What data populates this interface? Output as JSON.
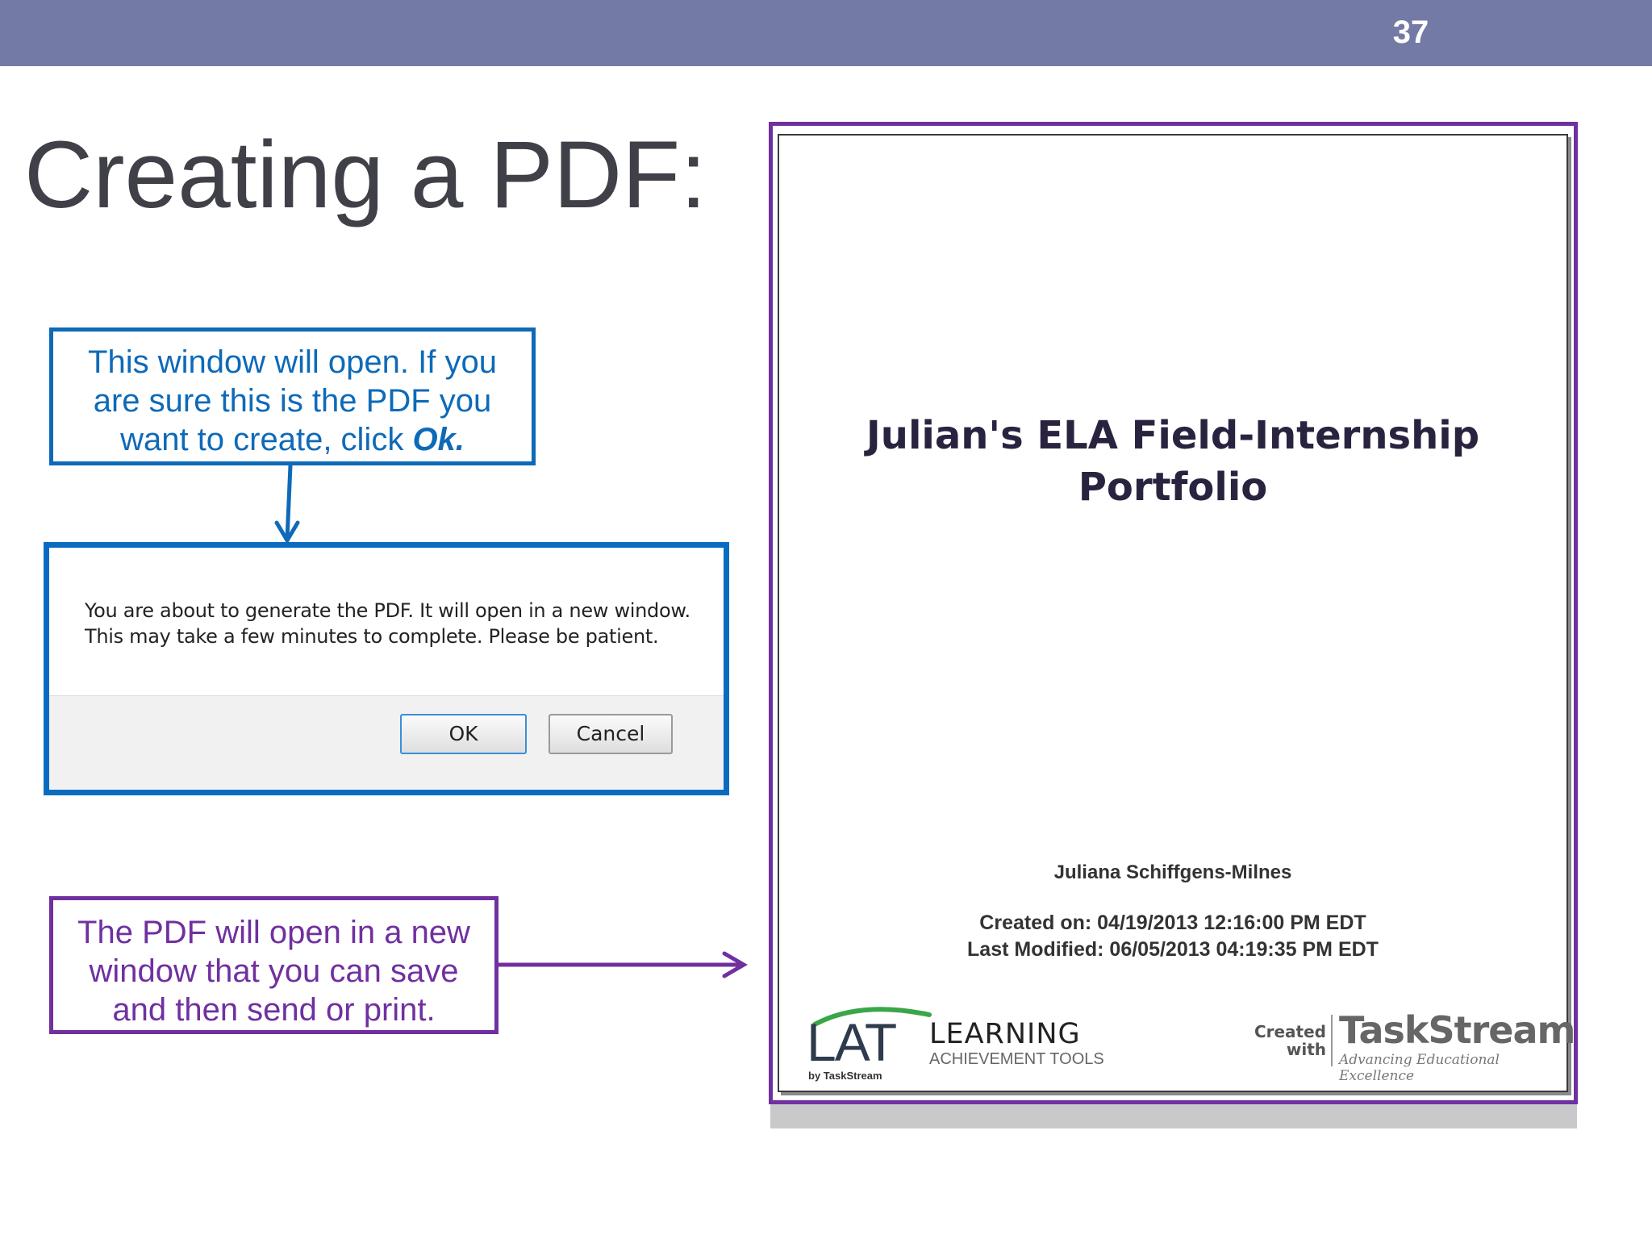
{
  "slide": {
    "number": "37",
    "title": "Creating a PDF:"
  },
  "callout_top": {
    "lines": [
      "This window will open. If you",
      "are sure this is the PDF you"
    ],
    "line3_prefix": "want to create, click ",
    "line3_emphasis": "Ok."
  },
  "dialog": {
    "message_line1": "You are about to generate the PDF. It will open in a new window.",
    "message_line2": "This may take a few minutes to complete. Please be patient.",
    "ok_label": "OK",
    "cancel_label": "Cancel"
  },
  "callout_bottom": {
    "lines": [
      "The PDF will open in a new",
      "window that you can save",
      "and then send or print."
    ]
  },
  "pdf_preview": {
    "title_line1": "Julian's ELA Field-Internship",
    "title_line2": "Portfolio",
    "author": "Juliana Schiffgens-Milnes",
    "created_on": "Created on: 04/19/2013 12:16:00 PM EDT",
    "last_modified": "Last Modified: 06/05/2013 04:19:35 PM EDT",
    "lat_logo": {
      "letters": "LAT",
      "by": "by TaskStream",
      "learning": "LEARNING",
      "tools": "ACHIEVEMENT TOOLS"
    },
    "taskstream_logo": {
      "created": "Created",
      "with": "with",
      "name": "TaskStream",
      "tagline": "Advancing Educational Excellence"
    }
  },
  "colors": {
    "topbar": "#747aa6",
    "blue_accent": "#0e6ab8",
    "purple_accent": "#7030a0",
    "title_text": "#404048"
  }
}
